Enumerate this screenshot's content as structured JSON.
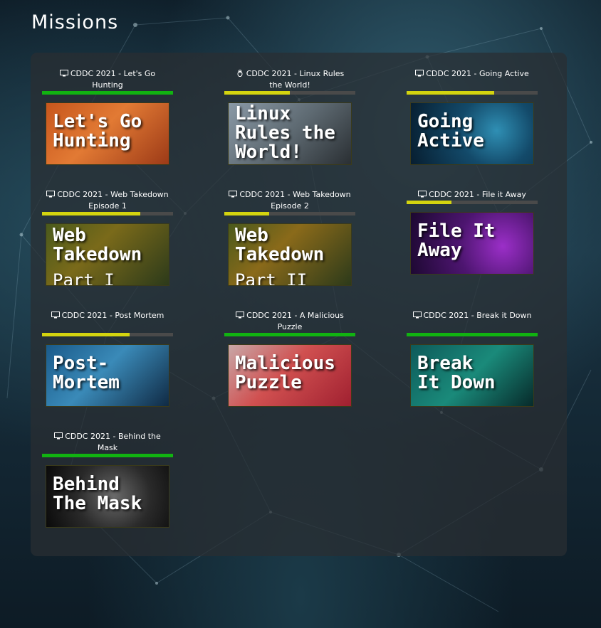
{
  "page_title": "Missions",
  "colors": {
    "green": "#11b311",
    "yellow": "#d4d40f",
    "track": "#4a4a4a"
  },
  "missions": [
    {
      "title": "CDDC 2021 - Let's Go Hunting",
      "icon": "monitor-icon",
      "progress": 1.0,
      "bar_color": "green",
      "thumb_text": "Let's Go\nHunting",
      "thumb_sub": "",
      "thumb_bg": "linear-gradient(135deg,#c7561d 0%,#e27a34 45%,#9c3a17 100%)"
    },
    {
      "title": "CDDC 2021 - Linux Rules the World!",
      "icon": "linux-icon",
      "progress": 0.5,
      "bar_color": "yellow",
      "thumb_text": "Linux\nRules the\nWorld!",
      "thumb_sub": "",
      "thumb_bg": "linear-gradient(135deg,#8a99a6 0%,#5e6a72 50%,#2a2f33 100%)"
    },
    {
      "title": "CDDC 2021 - Going Active",
      "icon": "monitor-icon",
      "progress": 0.67,
      "bar_color": "yellow",
      "thumb_text": "Going\nActive",
      "thumb_sub": "",
      "thumb_bg": "radial-gradient(circle at 70% 45%,#2f8fb4 0%,#134a6a 40%,#071e30 100%)"
    },
    {
      "title": "CDDC 2021 - Web Takedown Episode 1",
      "icon": "monitor-icon",
      "progress": 0.75,
      "bar_color": "yellow",
      "thumb_text": "Web\nTakedown",
      "thumb_sub": "Part I",
      "thumb_bg": "linear-gradient(135deg,#4a5a1c 0%,#7a6a1a 40%,#2c3a1a 100%)"
    },
    {
      "title": "CDDC 2021 - Web Takedown Episode 2",
      "icon": "monitor-icon",
      "progress": 0.34,
      "bar_color": "yellow",
      "thumb_text": "Web\nTakedown",
      "thumb_sub": "Part II",
      "thumb_bg": "linear-gradient(135deg,#4a5a1c 0%,#8a6a1a 40%,#2c3a1a 100%)"
    },
    {
      "title": "CDDC 2021 - File it Away",
      "icon": "monitor-icon",
      "progress": 0.34,
      "bar_color": "yellow",
      "thumb_text": "File It\nAway",
      "thumb_sub": "",
      "thumb_bg": "radial-gradient(circle at 75% 55%,#9b2fc8 0%,#4d1570 45%,#1c0830 100%)"
    },
    {
      "title": "CDDC 2021 - Post Mortem",
      "icon": "monitor-icon",
      "progress": 0.67,
      "bar_color": "yellow",
      "thumb_text": "Post-\nMortem",
      "thumb_sub": "",
      "thumb_bg": "linear-gradient(135deg,#1a5a8a 0%,#3a8ab8 45%,#102a44 100%)"
    },
    {
      "title": "CDDC 2021 - A Malicious Puzzle",
      "icon": "monitor-icon",
      "progress": 1.0,
      "bar_color": "green",
      "thumb_text": "Malicious\nPuzzle",
      "thumb_sub": "",
      "thumb_bg": "linear-gradient(135deg,#c8a8a8 0%,#d05050 45%,#a02030 100%)"
    },
    {
      "title": "CDDC 2021 - Break it Down",
      "icon": "monitor-icon",
      "progress": 1.0,
      "bar_color": "green",
      "thumb_text": "Break\nIt Down",
      "thumb_sub": "",
      "thumb_bg": "linear-gradient(135deg,#0e5a5a 0%,#1a8a7a 50%,#072a2a 100%)"
    },
    {
      "title": "CDDC 2021 - Behind the Mask",
      "icon": "monitor-icon",
      "progress": 1.0,
      "bar_color": "green",
      "thumb_text": "Behind\nThe Mask",
      "thumb_sub": "",
      "thumb_bg": "radial-gradient(circle at 55% 50%,#6a6a6a 0%,#2a2a2a 50%,#0a0a0a 100%)"
    }
  ]
}
